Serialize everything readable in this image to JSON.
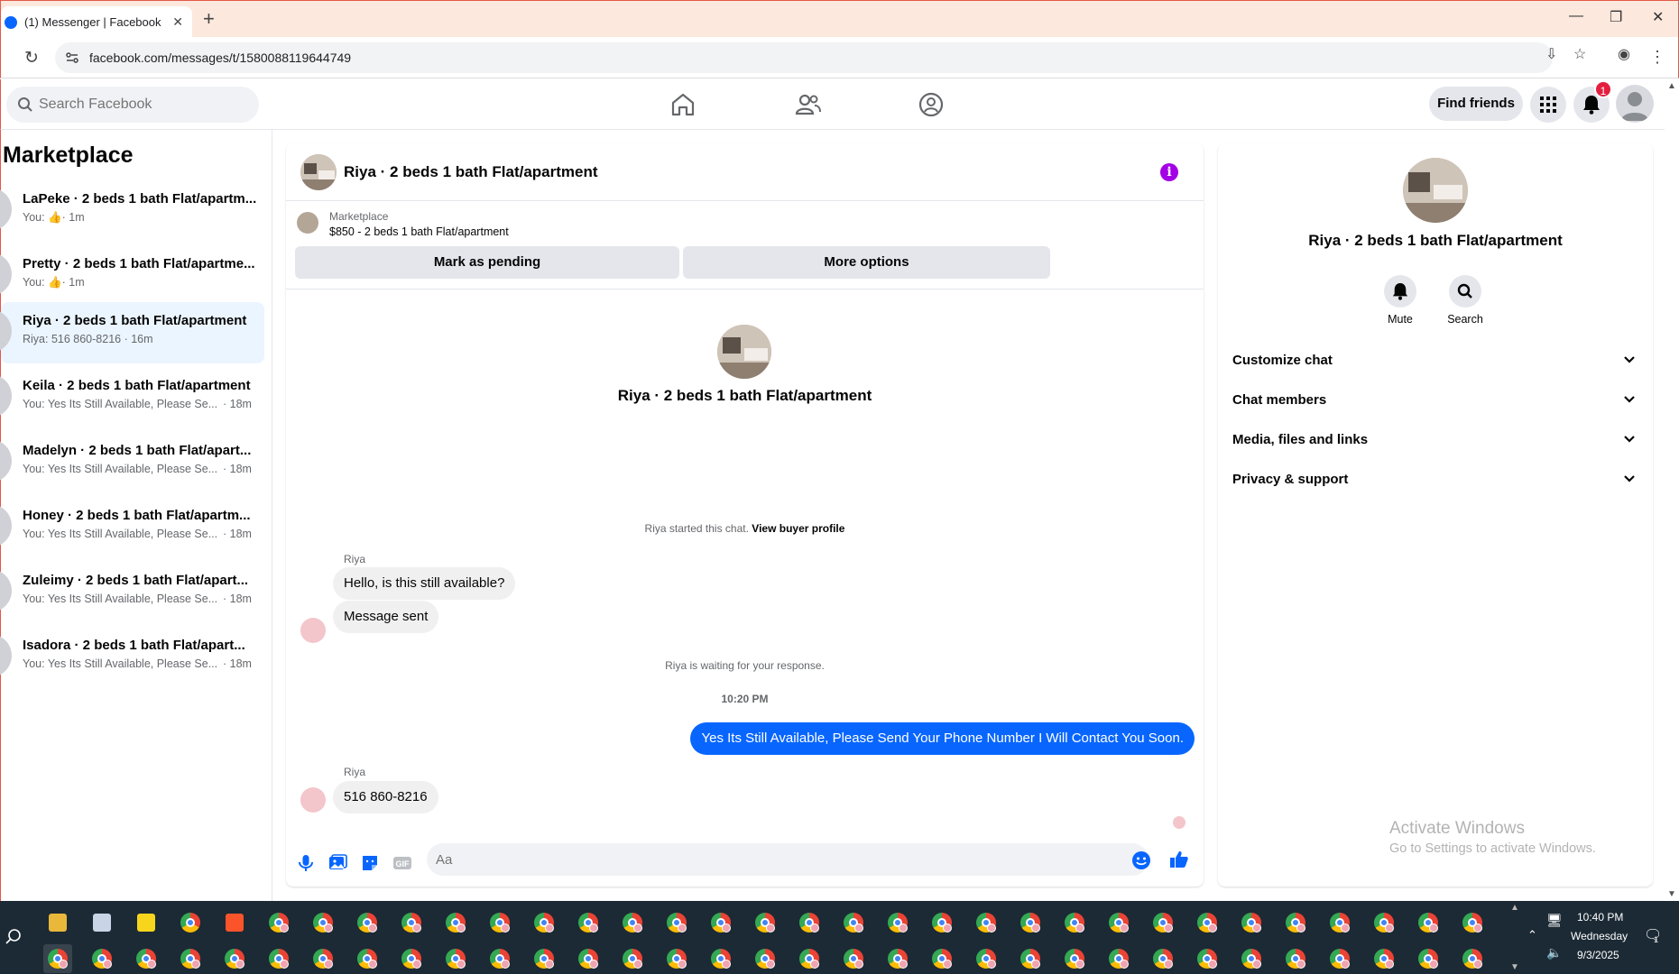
{
  "browser": {
    "tab_title": "(1) Messenger | Facebook",
    "url": "facebook.com/messages/t/1580088119644749"
  },
  "header": {
    "search_placeholder": "Search Facebook",
    "find_friends": "Find friends",
    "notif_count": "1"
  },
  "sidebar": {
    "title": "Marketplace",
    "conversations": [
      {
        "name": "LaPeke · 2 beds 1 bath Flat/apartm...",
        "sub": "You: ",
        "time": "· 1m",
        "like": true
      },
      {
        "name": "Pretty · 2 beds 1 bath Flat/apartme...",
        "sub": "You: ",
        "time": "· 1m",
        "like": true
      },
      {
        "name": "Riya · 2 beds 1 bath Flat/apartment",
        "sub": "Riya: 516 860-8216 · 16m",
        "time": "",
        "active": true
      },
      {
        "name": "Keila · 2 beds 1 bath Flat/apartment",
        "sub": "You: Yes Its Still Available, Please Se...",
        "time": "· 18m"
      },
      {
        "name": "Madelyn · 2 beds 1 bath Flat/apart...",
        "sub": "You: Yes Its Still Available, Please Se...",
        "time": "· 18m"
      },
      {
        "name": "Honey · 2 beds 1 bath Flat/apartm...",
        "sub": "You: Yes Its Still Available, Please Se...",
        "time": "· 18m"
      },
      {
        "name": "Zuleimy · 2 beds 1 bath Flat/apart...",
        "sub": "You: Yes Its Still Available, Please Se...",
        "time": "· 18m"
      },
      {
        "name": "Isadora · 2 beds 1 bath Flat/apart...",
        "sub": "You: Yes Its Still Available, Please Se...",
        "time": "· 18m"
      }
    ]
  },
  "chat": {
    "title": "Riya · 2 beds 1 bath Flat/apartment",
    "marketplace_label": "Marketplace",
    "listing": "$850 - 2 beds 1 bath Flat/apartment",
    "mark_pending": "Mark as pending",
    "more_options": "More options",
    "intro_name": "Riya · 2 beds 1 bath Flat/apartment",
    "started_text": "Riya started this chat.",
    "view_buyer": "View buyer profile",
    "sender1": "Riya",
    "msg1": "Hello, is this still available?",
    "msg2": "Message sent",
    "waiting": "Riya is waiting for your response.",
    "timestamp": "10:20 PM",
    "my_msg": "Yes Its Still Available, Please Send Your Phone Number I Will Contact You Soon.",
    "sender2": "Riya",
    "msg3": "516 860-8216",
    "composer_placeholder": "Aa"
  },
  "info_panel": {
    "name": "Riya · 2 beds 1 bath Flat/apartment",
    "mute": "Mute",
    "search": "Search",
    "rows": [
      "Customize chat",
      "Chat members",
      "Media, files and links",
      "Privacy & support"
    ]
  },
  "watermark": {
    "line1": "Activate Windows",
    "line2": "Go to Settings to activate Windows."
  },
  "taskbar": {
    "time": "10:40 PM",
    "day": "Wednesday",
    "date": "9/3/2025",
    "notif_count": "1"
  },
  "colors": {
    "accent": "#0866ff",
    "info": "#a300e6",
    "badge": "#e41e3f"
  }
}
